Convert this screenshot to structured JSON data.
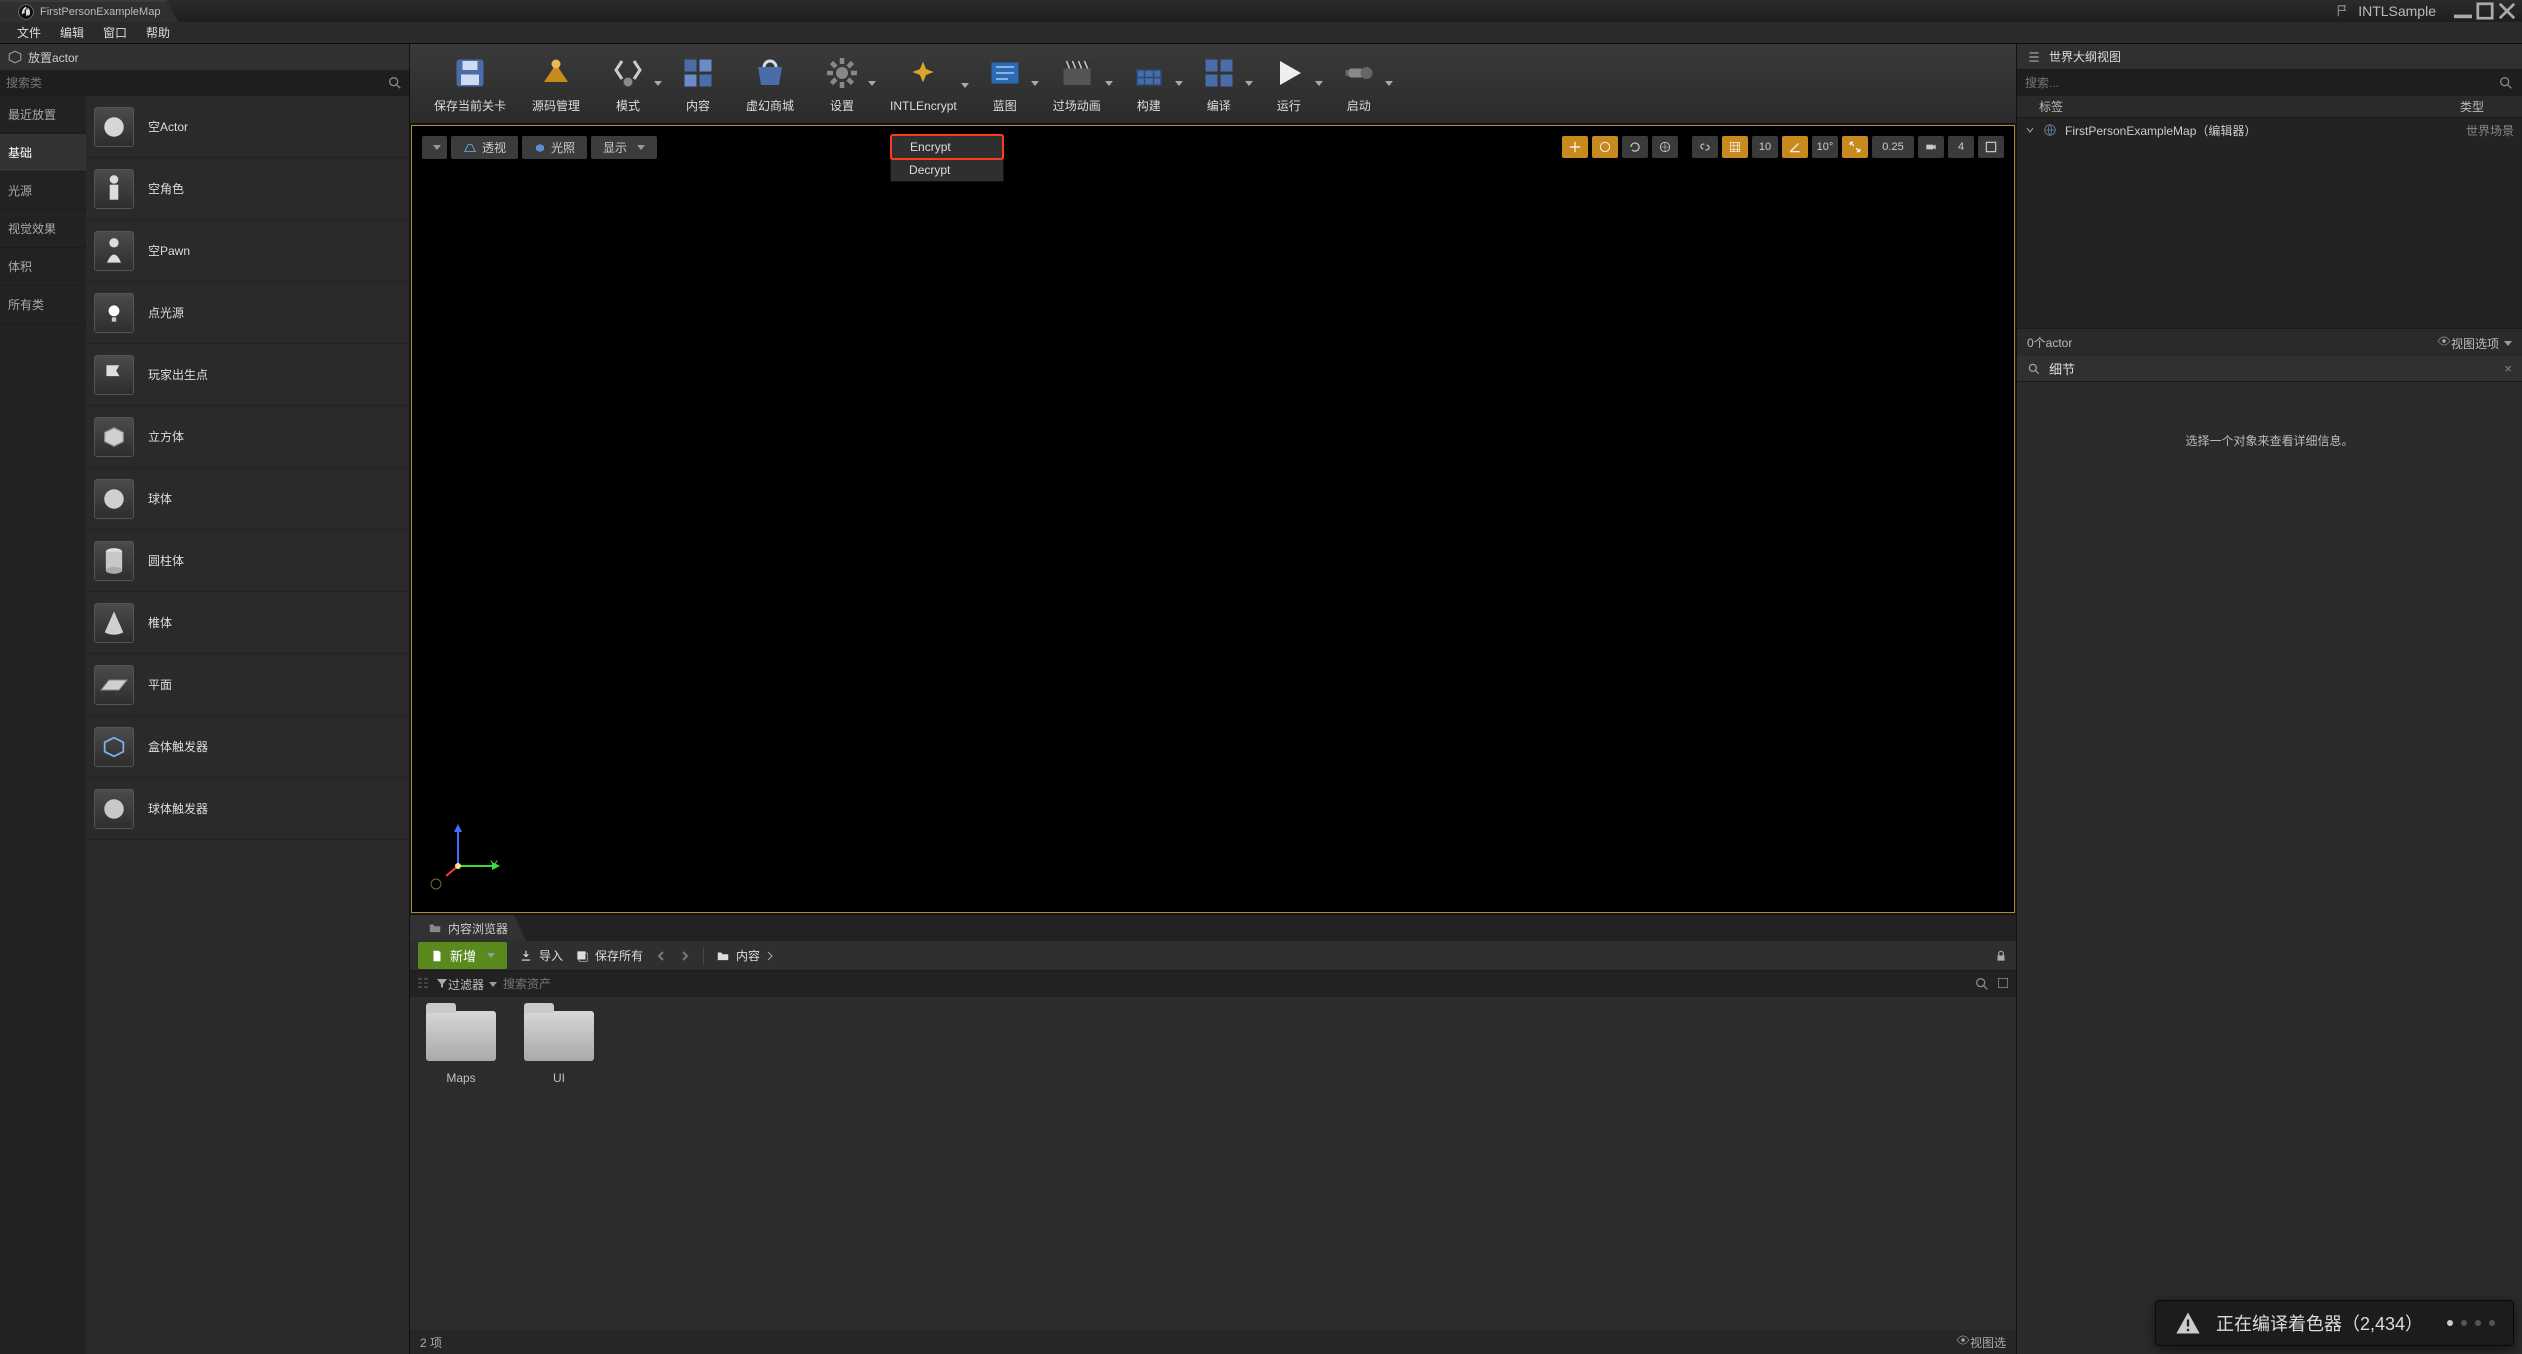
{
  "titlebar": {
    "tab": "FirstPersonExampleMap",
    "project": "INTLSample"
  },
  "menubar": [
    "文件",
    "编辑",
    "窗口",
    "帮助"
  ],
  "placeActor": {
    "title": "放置actor",
    "searchPlaceholder": "搜索类",
    "categories": [
      "最近放置",
      "基础",
      "光源",
      "视觉效果",
      "体积",
      "所有类"
    ],
    "activeCategory": 1,
    "items": [
      "空Actor",
      "空角色",
      "空Pawn",
      "点光源",
      "玩家出生点",
      "立方体",
      "球体",
      "圆柱体",
      "椎体",
      "平面",
      "盒体触发器",
      "球体触发器"
    ]
  },
  "toolbar": [
    {
      "label": "保存当前关卡"
    },
    {
      "label": "源码管理"
    },
    {
      "label": "模式",
      "dd": true
    },
    {
      "label": "内容"
    },
    {
      "label": "虚幻商城"
    },
    {
      "label": "设置",
      "dd": true
    },
    {
      "label": "INTLEncrypt",
      "dd": true
    },
    {
      "label": "蓝图",
      "dd": true
    },
    {
      "label": "过场动画",
      "dd": true
    },
    {
      "label": "构建",
      "dd": true
    },
    {
      "label": "编译",
      "dd": true
    },
    {
      "label": "运行",
      "dd": true
    },
    {
      "label": "启动",
      "dd": true
    }
  ],
  "intlMenu": {
    "encrypt": "Encrypt",
    "decrypt": "Decrypt"
  },
  "viewportTop": {
    "persp": "透视",
    "lit": "光照",
    "show": "显示"
  },
  "viewportRight": {
    "snap1": "10",
    "angle": "10°",
    "scale": "0.25",
    "cam": "4"
  },
  "gizmoLabel": "Y",
  "contentBrowser": {
    "tabTitle": "内容浏览器",
    "addNew": "新增",
    "import": "导入",
    "saveAll": "保存所有",
    "pathLabel": "内容",
    "filters": "过滤器",
    "filterPlaceholder": "搜索资产",
    "folders": [
      "Maps",
      "UI"
    ],
    "status": "2 项",
    "viewOptions": "视图选"
  },
  "outliner": {
    "title": "世界大纲视图",
    "searchPlaceholder": "搜索...",
    "col1": "标签",
    "col2": "类型",
    "row": {
      "name": "FirstPersonExampleMap（编辑器）",
      "type": "世界场景"
    },
    "footer": "0个actor",
    "viewOptions": "视图选项"
  },
  "details": {
    "title": "细节",
    "empty": "选择一个对象来查看详细信息。"
  },
  "toast": "正在编译着色器（2,434）"
}
